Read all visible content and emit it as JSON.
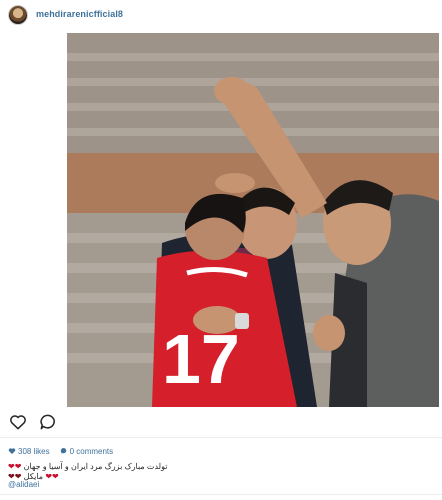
{
  "account": {
    "username": "mehdirarenicfficial8"
  },
  "actions": {
    "like_icon": "heart-outline-icon",
    "comment_icon": "speech-bubble-icon"
  },
  "stats": {
    "likes": "308 likes",
    "comments": "0 comments"
  },
  "caption": {
    "line1_text": "تولدت مبارک بزرگ مرد ایران و آسیا و جهان",
    "line1_emojis": "❤❤",
    "line2_text": "مایکل",
    "line2_emojis": "❤❤",
    "line2_prefix": "❤❤",
    "mention": "@alidaei"
  },
  "colors": {
    "link": "#3f729b",
    "heart": "#c8102e",
    "jersey": "#d51f2a"
  }
}
